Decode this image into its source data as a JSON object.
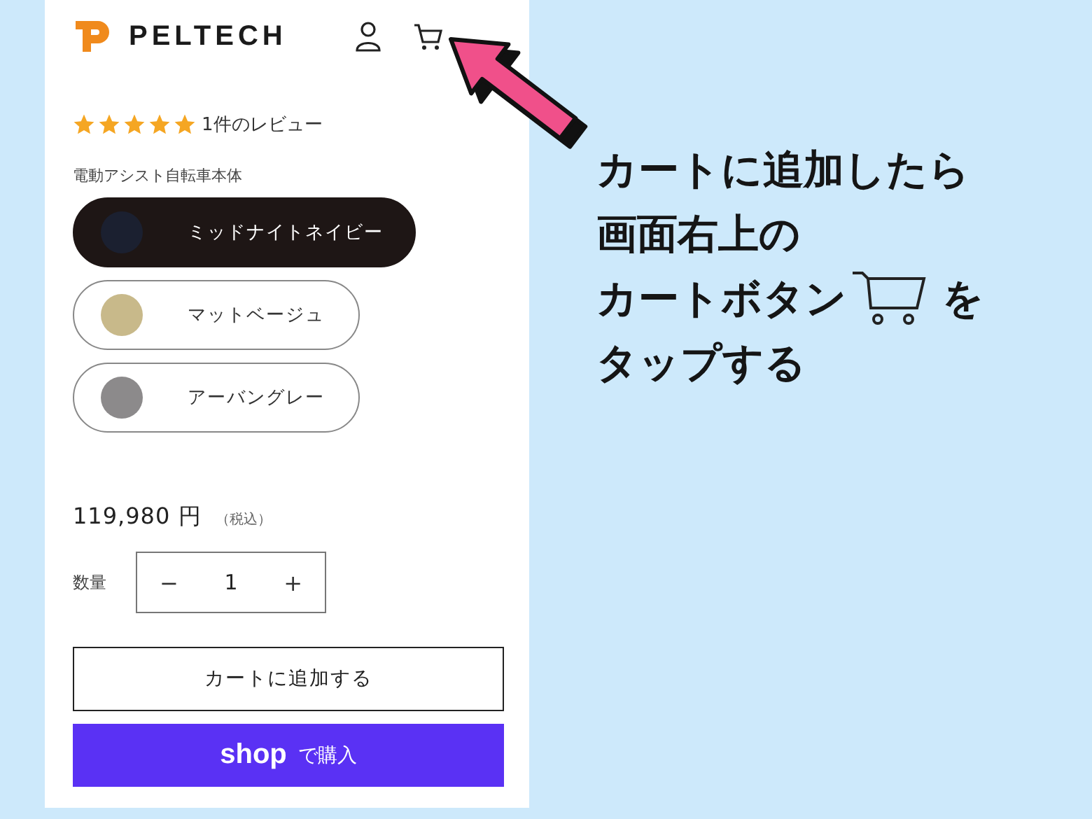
{
  "header": {
    "brand": "PELTECH"
  },
  "rating": {
    "stars": 5,
    "label": "1件のレビュー"
  },
  "variant": {
    "label": "電動アシスト自転車本体",
    "options": [
      {
        "name": "ミッドナイトネイビー",
        "color": "#1b2030",
        "selected": true
      },
      {
        "name": "マットベージュ",
        "color": "#c8b98a",
        "selected": false
      },
      {
        "name": "アーバングレー",
        "color": "#8c8a8b",
        "selected": false
      }
    ]
  },
  "price": {
    "amount": "119,980 円",
    "tax_note": "（税込）"
  },
  "quantity": {
    "label": "数量",
    "minus": "−",
    "value": "1",
    "plus": "+"
  },
  "add_to_cart": "カートに追加する",
  "shop_pay": {
    "brand": "shop",
    "label": "で購入"
  },
  "annotation": {
    "lines": [
      {
        "text": "カートに追加したら"
      },
      {
        "text": "画面右上の"
      },
      {
        "text": "カートボタン",
        "kind": "with-icon",
        "after": "を"
      },
      {
        "text": "タップする"
      }
    ]
  }
}
